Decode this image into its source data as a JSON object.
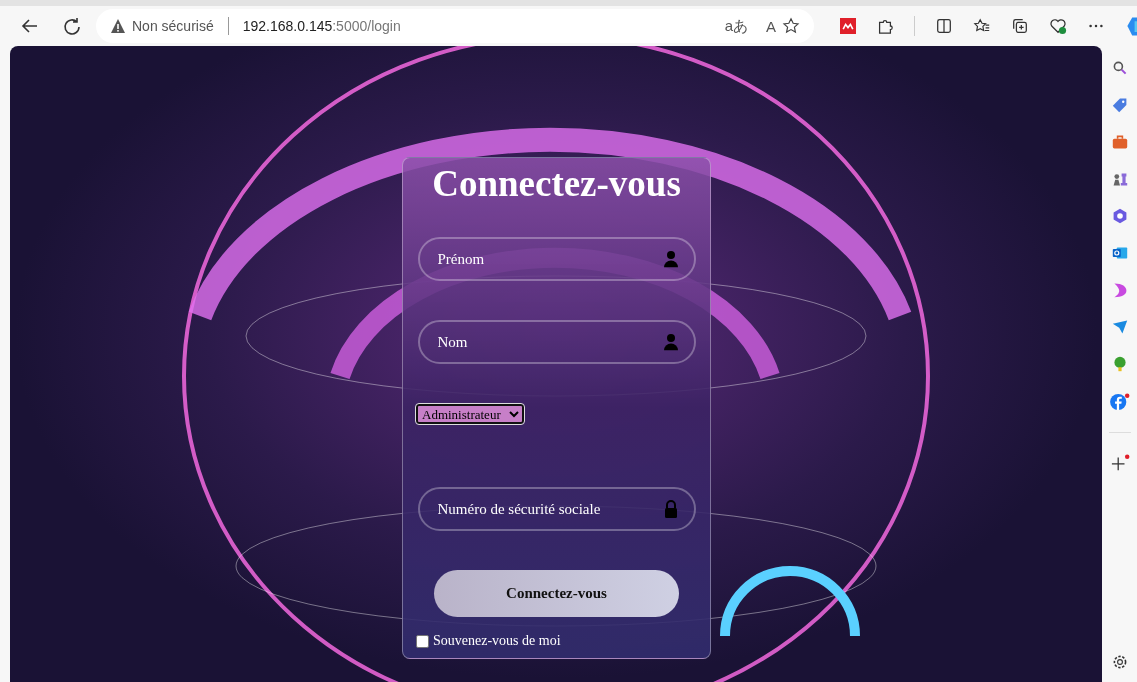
{
  "browser": {
    "security_label": "Non sécurisé",
    "address_host": "192.168.0.145",
    "address_path": ":5000/login",
    "translate_glyph": "aあ",
    "read_aloud_glyph": "A"
  },
  "form": {
    "title": "Connectez-vous",
    "fields": [
      {
        "kind": "text",
        "placeholder": "Prénom"
      },
      {
        "kind": "text",
        "placeholder": "Nom"
      },
      {
        "kind": "select",
        "value": "Administrateur"
      },
      {
        "kind": "secret",
        "placeholder": "Numéro de sécurité sociale"
      }
    ],
    "submit": "Connectez-vous",
    "remember": {
      "label": "Souvenez-vous de moi",
      "checked": false
    }
  }
}
